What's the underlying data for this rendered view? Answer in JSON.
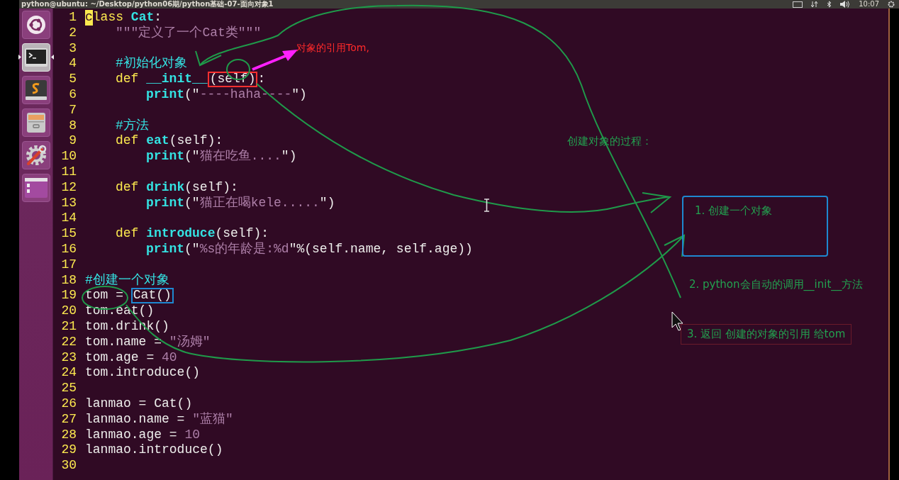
{
  "top_panel": {
    "title": "python@ubuntu: ~/Desktop/python06期/python基础-07-面向对象1",
    "clock": "10:07"
  },
  "launcher": [
    {
      "kind": "dash",
      "selected": false
    },
    {
      "kind": "terminal",
      "selected": true
    },
    {
      "kind": "editor",
      "selected": false
    },
    {
      "kind": "files",
      "selected": false
    },
    {
      "kind": "settings",
      "selected": false
    },
    {
      "kind": "workspaces",
      "selected": false
    }
  ],
  "editor": {
    "lines": [
      {
        "number": "1",
        "kind": "top",
        "tokens": [
          {
            "kind": "cursor",
            "text": "c"
          },
          {
            "kind": "keyword",
            "text": "lass "
          },
          {
            "kind": "name",
            "text": "Cat"
          },
          {
            "kind": "plain",
            "text": ":"
          }
        ]
      },
      {
        "number": "2",
        "kind": "body",
        "tokens": [
          {
            "kind": "string",
            "text": "\"\"\"定义了一个Cat类\"\"\""
          }
        ]
      },
      {
        "number": "3",
        "kind": "top"
      },
      {
        "number": "4",
        "kind": "body",
        "tokens": [
          {
            "kind": "comment",
            "text": "#初始化对象"
          }
        ]
      },
      {
        "number": "5",
        "kind": "body",
        "tokens": [
          {
            "kind": "keyword",
            "text": "def "
          },
          {
            "kind": "name",
            "text": "__init__"
          },
          {
            "kind": "plain",
            "text": "(self)",
            "color": "#ff3030"
          },
          {
            "kind": "plain",
            "text": ":"
          }
        ]
      },
      {
        "number": "6",
        "kind": "nested",
        "tokens": [
          {
            "kind": "name",
            "text": "print"
          },
          {
            "kind": "plain",
            "text": "(\""
          },
          {
            "kind": "string",
            "text": "----haha----"
          },
          {
            "kind": "plain",
            "text": "\")"
          }
        ]
      },
      {
        "number": "7",
        "kind": "top"
      },
      {
        "number": "8",
        "kind": "body",
        "tokens": [
          {
            "kind": "comment",
            "text": "#方法"
          }
        ]
      },
      {
        "number": "9",
        "kind": "body",
        "tokens": [
          {
            "kind": "keyword",
            "text": "def "
          },
          {
            "kind": "name",
            "text": "eat"
          },
          {
            "kind": "plain",
            "text": "(self):"
          }
        ]
      },
      {
        "number": "10",
        "kind": "nested",
        "tokens": [
          {
            "kind": "name",
            "text": "print"
          },
          {
            "kind": "plain",
            "text": "(\""
          },
          {
            "kind": "string",
            "text": "猫在吃鱼...."
          },
          {
            "kind": "plain",
            "text": "\")"
          }
        ]
      },
      {
        "number": "11",
        "kind": "top"
      },
      {
        "number": "12",
        "kind": "body",
        "tokens": [
          {
            "kind": "keyword",
            "text": "def "
          },
          {
            "kind": "name",
            "text": "drink"
          },
          {
            "kind": "plain",
            "text": "(self):"
          }
        ]
      },
      {
        "number": "13",
        "kind": "nested",
        "tokens": [
          {
            "kind": "name",
            "text": "print"
          },
          {
            "kind": "plain",
            "text": "(\""
          },
          {
            "kind": "string",
            "text": "猫正在喝kele....."
          },
          {
            "kind": "plain",
            "text": "\")"
          }
        ]
      },
      {
        "number": "14",
        "kind": "top"
      },
      {
        "number": "15",
        "kind": "body",
        "tokens": [
          {
            "kind": "keyword",
            "text": "def "
          },
          {
            "kind": "name",
            "text": "introduce"
          },
          {
            "kind": "plain",
            "text": "(self):"
          }
        ]
      },
      {
        "number": "16",
        "kind": "nested",
        "tokens": [
          {
            "kind": "name",
            "text": "print"
          },
          {
            "kind": "plain",
            "text": "(\""
          },
          {
            "kind": "string",
            "text": "%s的年龄是:%d"
          },
          {
            "kind": "plain",
            "text": "\"%(self.name, self.age))"
          }
        ]
      },
      {
        "number": "17",
        "kind": "top"
      },
      {
        "number": "18",
        "kind": "top",
        "tokens": [
          {
            "kind": "comment",
            "text": "#创建一个对象"
          }
        ]
      },
      {
        "number": "19",
        "kind": "top",
        "tokens": [
          {
            "kind": "plain",
            "text": "tom = "
          },
          {
            "kind": "plain",
            "text": "Cat()",
            "color": "#1e88d0"
          }
        ]
      },
      {
        "number": "20",
        "kind": "top",
        "tokens": [
          {
            "kind": "plain",
            "text": "tom.eat()"
          }
        ]
      },
      {
        "number": "21",
        "kind": "top",
        "tokens": [
          {
            "kind": "plain",
            "text": "tom.drink()"
          }
        ]
      },
      {
        "number": "22",
        "kind": "top",
        "tokens": [
          {
            "kind": "plain",
            "text": "tom.name = "
          },
          {
            "kind": "string",
            "text": "\"汤姆\""
          }
        ]
      },
      {
        "number": "23",
        "kind": "top",
        "tokens": [
          {
            "kind": "plain",
            "text": "tom.age = "
          },
          {
            "kind": "number",
            "text": "40"
          }
        ]
      },
      {
        "number": "24",
        "kind": "top",
        "tokens": [
          {
            "kind": "plain",
            "text": "tom.introduce()"
          }
        ]
      },
      {
        "number": "25",
        "kind": "top"
      },
      {
        "number": "26",
        "kind": "top",
        "tokens": [
          {
            "kind": "plain",
            "text": "lanmao = Cat()"
          }
        ]
      },
      {
        "number": "27",
        "kind": "top",
        "tokens": [
          {
            "kind": "plain",
            "text": "lanmao.name = "
          },
          {
            "kind": "string",
            "text": "\"蓝猫\""
          }
        ]
      },
      {
        "number": "28",
        "kind": "top",
        "tokens": [
          {
            "kind": "plain",
            "text": "lanmao.age = "
          },
          {
            "kind": "number",
            "text": "10"
          }
        ]
      },
      {
        "number": "29",
        "kind": "top",
        "tokens": [
          {
            "kind": "plain",
            "text": "lanmao.introduce()"
          }
        ]
      },
      {
        "number": "30",
        "kind": "top"
      }
    ]
  },
  "annotations": [
    {
      "kind": "note-red",
      "text": "对象的引用Tom,"
    },
    {
      "kind": "note-green",
      "text": "创建对象的过程："
    },
    {
      "kind": "boxed-blue",
      "text": "1. 创建一个对象"
    },
    {
      "kind": "note-green",
      "text": "2. python会自动的调用__init__方法"
    },
    {
      "kind": "boxed-red",
      "text": "3. 返回 创建的对象的引用 给tom"
    }
  ]
}
